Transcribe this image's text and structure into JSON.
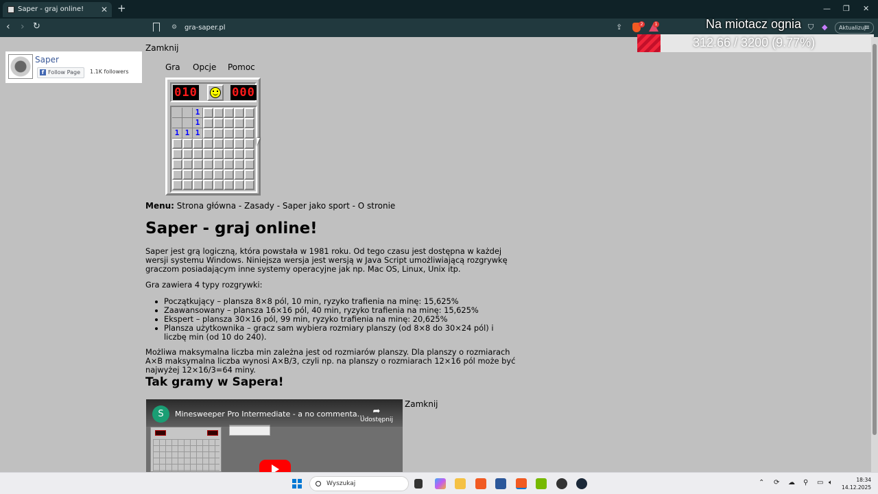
{
  "browser": {
    "tab_title": "Saper - graj online!",
    "tab_close": "✕",
    "new_tab": "+",
    "url": "gra-saper.pl",
    "update_label": "Aktualizuj",
    "brave_badge": "2",
    "rewards_badge": "1"
  },
  "overlay": {
    "title": "Na miotacz ognia",
    "progress_text": "312.66 / 3200 (9.77%)",
    "progress_fraction": 0.0977,
    "fill_color": "#e5152f"
  },
  "facebook": {
    "page_name": "Saper",
    "follow_label": "Follow Page",
    "followers": "1.1K followers"
  },
  "page": {
    "close_label": "Zamknij",
    "game_menu": [
      "Gra",
      "Opcje",
      "Pomoc"
    ],
    "mines_counter": "010",
    "time_counter": "000",
    "board": [
      [
        "",
        "",
        "1",
        null,
        null,
        null,
        null,
        null
      ],
      [
        "",
        "",
        "1",
        null,
        null,
        null,
        null,
        null
      ],
      [
        "1",
        "1",
        "1",
        null,
        null,
        null,
        null,
        null
      ],
      [
        null,
        null,
        null,
        null,
        null,
        null,
        null,
        null
      ],
      [
        null,
        null,
        null,
        null,
        null,
        null,
        null,
        null
      ],
      [
        null,
        null,
        null,
        null,
        null,
        null,
        null,
        null
      ],
      [
        null,
        null,
        null,
        null,
        null,
        null,
        null,
        null
      ],
      [
        null,
        null,
        null,
        null,
        null,
        null,
        null,
        null
      ]
    ],
    "menu_label": "Menu:",
    "menu_links": "Strona główna - Zasady - Saper jako sport - O stronie",
    "heading": "Saper - graj online!",
    "intro": "Saper jest grą logiczną, która powstała w 1981 roku. Od tego czasu jest dostępna w każdej wersji systemu Windows. Niniejsza wersja jest wersją w Java Script umożliwiającą rozgrywkę graczom posiadającym inne systemy operacyjne jak np. Mac OS, Linux, Unix itp.",
    "types_intro": "Gra zawiera 4 typy rozgrywki:",
    "types": [
      "Początkujący – plansza 8×8 pól, 10 min, ryzyko trafienia na minę: 15,625%",
      "Zaawansowany – plansza 16×16 pól, 40 min, ryzyko trafienia na minę: 15,625%",
      "Ekspert – plansza 30×16 pól, 99 min, ryzyko trafienia na minę: 20,625%",
      "Plansza użytkownika – gracz sam wybiera rozmiary planszy (od 8×8 do 30×24 pól) i liczbę min (od 10 do 240)."
    ],
    "max_mines": "Możliwa maksymalna liczba min zależna jest od rozmiarów planszy. Dla planszy o rozmiarach A×B maksymalna liczba wynosi A×B/3, czyli np. na planszy o rozmiarach 12×16 pól może być najwyżej 12×16/3=64 miny.",
    "subheading": "Tak gramy w Sapera!",
    "video_title": "Minesweeper Pro Intermediate - a no commenta...",
    "video_channel_initial": "S",
    "video_share": "Udostępnij",
    "video_close": "Zamknij"
  },
  "taskbar": {
    "search_placeholder": "Wyszukaj",
    "time": "18:34",
    "date": "14.12.2025"
  }
}
